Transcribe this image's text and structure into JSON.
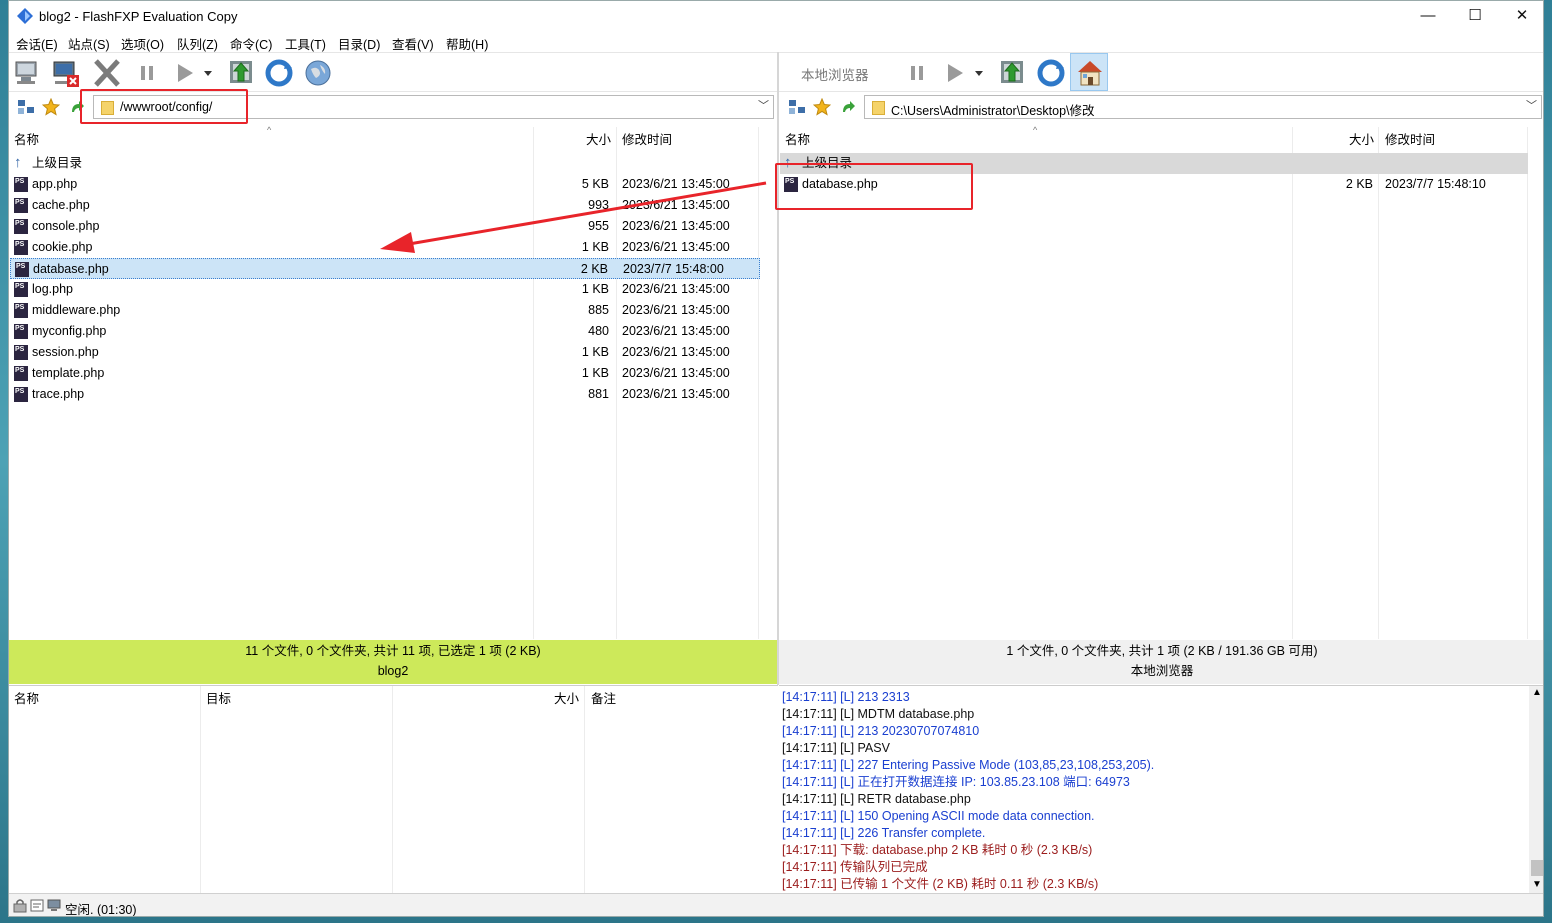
{
  "window": {
    "title": "blog2 - FlashFXP Evaluation Copy",
    "min": "—",
    "max": "☐",
    "close": "✕"
  },
  "menu": [
    "会话(E)",
    "站点(S)",
    "选项(O)",
    "队列(Z)",
    "命令(C)",
    "工具(T)",
    "目录(D)",
    "查看(V)",
    "帮助(H)"
  ],
  "right_toolbar_label": "本地浏览器",
  "left": {
    "path": "/wwwroot/config/",
    "headers": {
      "name": "名称",
      "size": "大小",
      "modified": "修改时间"
    },
    "parent": "上级目录",
    "files": [
      {
        "name": "app.php",
        "size": "5 KB",
        "modified": "2023/6/21 13:45:00"
      },
      {
        "name": "cache.php",
        "size": "993",
        "modified": "2023/6/21 13:45:00"
      },
      {
        "name": "console.php",
        "size": "955",
        "modified": "2023/6/21 13:45:00"
      },
      {
        "name": "cookie.php",
        "size": "1 KB",
        "modified": "2023/6/21 13:45:00"
      },
      {
        "name": "database.php",
        "size": "2 KB",
        "modified": "2023/7/7 15:48:00"
      },
      {
        "name": "log.php",
        "size": "1 KB",
        "modified": "2023/6/21 13:45:00"
      },
      {
        "name": "middleware.php",
        "size": "885",
        "modified": "2023/6/21 13:45:00"
      },
      {
        "name": "myconfig.php",
        "size": "480",
        "modified": "2023/6/21 13:45:00"
      },
      {
        "name": "session.php",
        "size": "1 KB",
        "modified": "2023/6/21 13:45:00"
      },
      {
        "name": "template.php",
        "size": "1 KB",
        "modified": "2023/6/21 13:45:00"
      },
      {
        "name": "trace.php",
        "size": "881",
        "modified": "2023/6/21 13:45:00"
      }
    ],
    "status": "11 个文件, 0 个文件夹, 共计 11 项, 已选定 1 项 (2 KB)",
    "site": "blog2"
  },
  "right": {
    "path": "C:\\Users\\Administrator\\Desktop\\修改",
    "headers": {
      "name": "名称",
      "size": "大小",
      "modified": "修改时间"
    },
    "parent": "上级目录",
    "files": [
      {
        "name": "database.php",
        "size": "2 KB",
        "modified": "2023/7/7 15:48:10"
      }
    ],
    "status": "1 个文件, 0 个文件夹, 共计 1 项 (2 KB / 191.36 GB 可用)",
    "site": "本地浏览器"
  },
  "queue": {
    "headers": [
      "名称",
      "目标",
      "大小",
      "备注"
    ]
  },
  "log": [
    {
      "text": "[14:17:11]  [L] 213 2313",
      "color": "#1a3fd0"
    },
    {
      "text": "[14:17:11]  [L] MDTM database.php",
      "color": "#111111"
    },
    {
      "text": "[14:17:11]  [L] 213 20230707074810",
      "color": "#1a3fd0"
    },
    {
      "text": "[14:17:11]  [L] PASV",
      "color": "#111111"
    },
    {
      "text": "[14:17:11]  [L] 227 Entering Passive Mode (103,85,23,108,253,205).",
      "color": "#1a3fd0"
    },
    {
      "text": "[14:17:11]  [L] 正在打开数据连接 IP: 103.85.23.108 端口: 64973",
      "color": "#1a3fd0"
    },
    {
      "text": "[14:17:11]  [L] RETR database.php",
      "color": "#111111"
    },
    {
      "text": "[14:17:11]  [L] 150 Opening ASCII mode data connection.",
      "color": "#1a3fd0"
    },
    {
      "text": "[14:17:11]  [L] 226 Transfer complete.",
      "color": "#1a3fd0"
    },
    {
      "text": "[14:17:11]  下载: database.php 2 KB 耗时 0 秒 (2.3 KB/s)",
      "color": "#9b1c1c"
    },
    {
      "text": "[14:17:11]  传输队列已完成",
      "color": "#9b1c1c"
    },
    {
      "text": "[14:17:11]  已传输 1 个文件 (2 KB) 耗时 0.11 秒 (2.3 KB/s)",
      "color": "#9b1c1c"
    }
  ],
  "bottom_status": "空闲. (01:30)",
  "colors": {
    "left_status_bg": "#cde95a",
    "selection_bg": "#cce4f7",
    "annotation": "#e8242a"
  }
}
